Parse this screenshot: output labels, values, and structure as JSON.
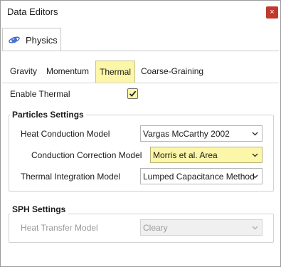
{
  "window": {
    "title": "Data Editors",
    "close_glyph": "×"
  },
  "main_tab": {
    "label": "Physics",
    "icon": "planet-icon"
  },
  "subtabs": [
    {
      "label": "Gravity",
      "active": false
    },
    {
      "label": "Momentum",
      "active": false
    },
    {
      "label": "Thermal",
      "active": true
    },
    {
      "label": "Coarse-Graining",
      "active": false
    }
  ],
  "enable_thermal": {
    "label": "Enable Thermal",
    "checked": true
  },
  "particles_settings": {
    "title": "Particles Settings",
    "heat_conduction_model": {
      "label": "Heat Conduction Model",
      "value": "Vargas McCarthy 2002"
    },
    "conduction_correction_model": {
      "label": "Conduction Correction Model",
      "value": "Morris et al. Area"
    },
    "thermal_integration_model": {
      "label": "Thermal Integration Model",
      "value": "Lumped Capacitance Method"
    }
  },
  "sph_settings": {
    "title": "SPH Settings",
    "heat_transfer_model": {
      "label": "Heat Transfer Model",
      "value": "Cleary",
      "disabled": true
    }
  },
  "colors": {
    "highlight": "#fbf6a8",
    "close_button": "#c0392b",
    "disabled_text": "#9a9a9a"
  }
}
